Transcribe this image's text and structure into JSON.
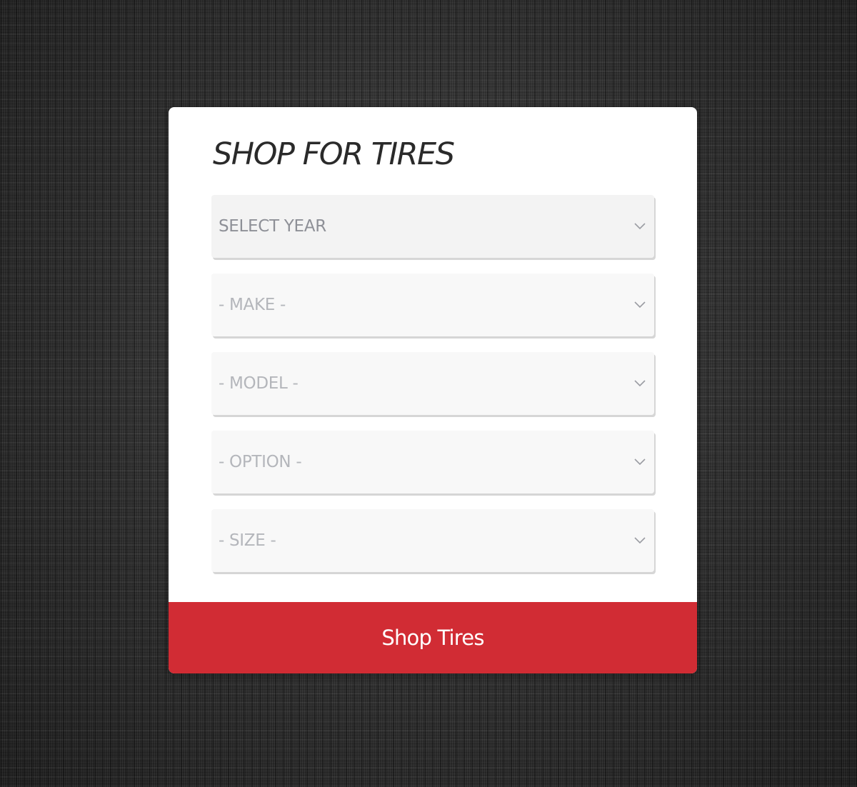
{
  "widget": {
    "title": "SHOP FOR TIRES",
    "selects": [
      {
        "label": "SELECT YEAR",
        "icon": "chevron-down-icon",
        "active": true
      },
      {
        "label": "- MAKE -",
        "icon": "chevron-down-icon",
        "active": false
      },
      {
        "label": "- MODEL -",
        "icon": "chevron-down-icon",
        "active": false
      },
      {
        "label": "- OPTION -",
        "icon": "chevron-down-icon",
        "active": false
      },
      {
        "label": "- SIZE -",
        "icon": "chevron-down-icon",
        "active": false
      }
    ],
    "button_label": "Shop Tires"
  },
  "colors": {
    "accent": "#d12c34",
    "title": "#2a2a2a",
    "select_background": "#f8f8f8",
    "placeholder_text": "#b4b6bb",
    "active_text": "#8e9097"
  }
}
